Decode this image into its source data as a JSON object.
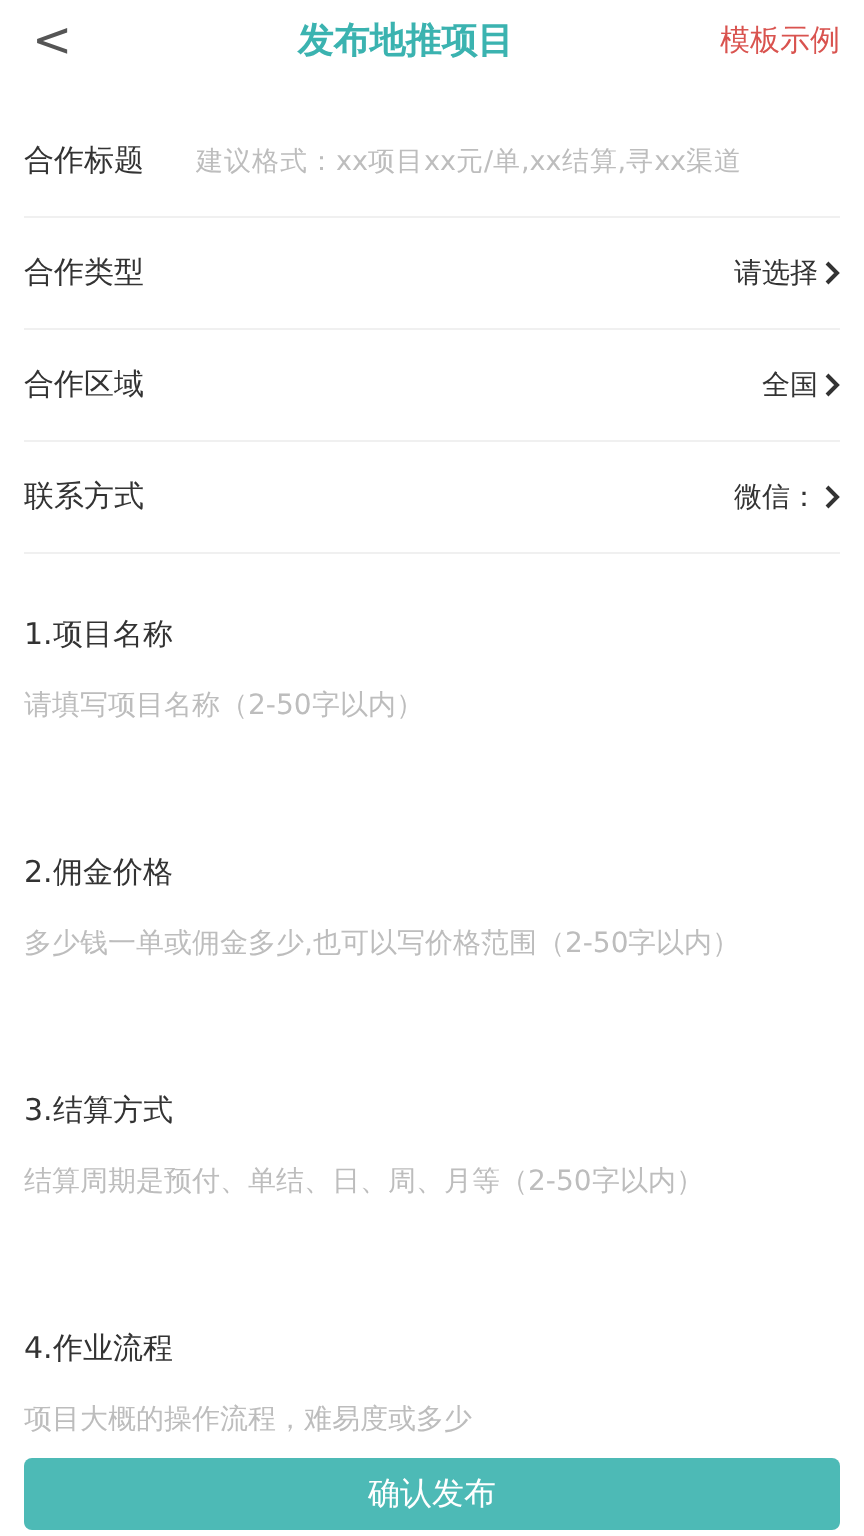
{
  "header": {
    "back": "<",
    "title": "发布地推项目",
    "action": "模板示例"
  },
  "rows": [
    {
      "kind": "input",
      "label": "合作标题",
      "placeholder": "建议格式：xx项目xx元/单,xx结算,寻xx渠道"
    },
    {
      "kind": "select",
      "label": "合作类型",
      "value": "请选择"
    },
    {
      "kind": "select",
      "label": "合作区域",
      "value": "全国"
    },
    {
      "kind": "select",
      "label": "联系方式",
      "value": "微信："
    }
  ],
  "sections": [
    {
      "label": "1.项目名称",
      "placeholder": "请填写项目名称（2-50字以内）"
    },
    {
      "label": "2.佣金价格",
      "placeholder": "多少钱一单或佣金多少,也可以写价格范围（2-50字以内）"
    },
    {
      "label": "3.结算方式",
      "placeholder": "结算周期是预付、单结、日、周、月等（2-50字以内）"
    },
    {
      "label": "4.作业流程",
      "placeholder": "项目大概的操作流程，难易度或多少"
    }
  ],
  "submit": "确认发布"
}
